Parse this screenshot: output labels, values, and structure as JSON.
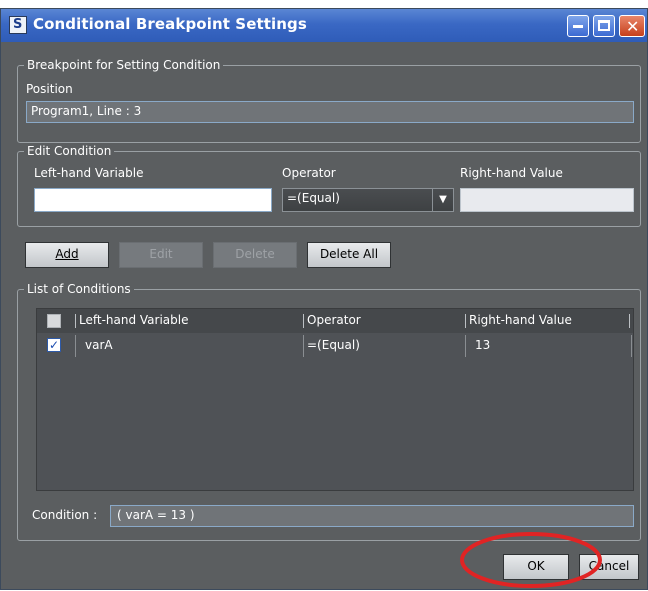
{
  "window": {
    "title": "Conditional Breakpoint Settings",
    "app_icon_letter": "S",
    "min_icon": "minimize-icon",
    "max_icon": "maximize-icon",
    "close_icon": "close-icon",
    "close_glyph": "✕"
  },
  "position_group": {
    "legend": "Breakpoint for Setting Condition",
    "label": "Position",
    "value": "Program1, Line : 3"
  },
  "edit_group": {
    "legend": "Edit Condition",
    "left_label": "Left-hand Variable",
    "left_value": "",
    "operator_label": "Operator",
    "operator_value": "=(Equal)",
    "right_label": "Right-hand Value",
    "right_value": "",
    "dropdown_icon": "chevron-down-icon",
    "dropdown_glyph": "▼"
  },
  "buttons": {
    "add": "Add",
    "edit": "Edit",
    "delete": "Delete",
    "delete_all": "Delete All",
    "ok": "OK",
    "cancel": "Cancel"
  },
  "list_group": {
    "legend": "List of Conditions",
    "columns": [
      "Left-hand Variable",
      "Operator",
      "Right-hand Value"
    ],
    "rows": [
      {
        "checked": true,
        "left": "varA",
        "operator": "=(Equal)",
        "right": "13"
      }
    ],
    "check_glyph": "✓"
  },
  "condition": {
    "label": "Condition :",
    "value": "( varA = 13 )"
  },
  "colors": {
    "dialog_bg": "#5b5e60",
    "title_bar": "#3a68c4",
    "highlight_circle": "#e02424"
  }
}
